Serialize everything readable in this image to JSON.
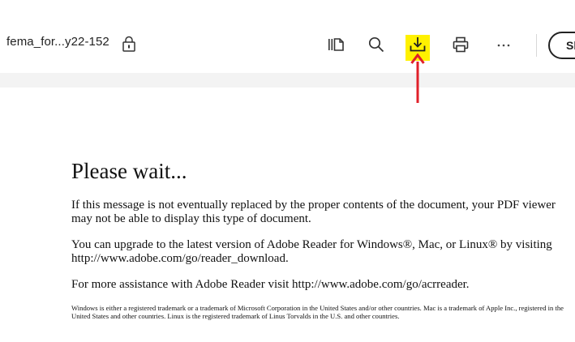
{
  "toolbar": {
    "doc_title": "fema_for...y22-152",
    "icons": [
      "page-thumbnails-icon",
      "search-icon",
      "download-icon",
      "print-icon",
      "more-options-icon",
      "lock-icon"
    ],
    "share_label": "Sh",
    "highlight_color": "#fff100",
    "arrow_color": "#e0202a"
  },
  "document": {
    "heading": "Please wait...",
    "paragraph_1": "If this message is not eventually replaced by the proper contents of the document, your PDF viewer may not be able to display this type of document.",
    "paragraph_2": "You can upgrade to the latest version of Adobe Reader for Windows®, Mac, or Linux® by visiting  http://www.adobe.com/go/reader_download.",
    "paragraph_3": "For more assistance with Adobe Reader visit  http://www.adobe.com/go/acrreader.",
    "fine_print": "Windows is either a registered trademark or a trademark of Microsoft Corporation in the United States and/or other countries. Mac is a trademark of Apple Inc., registered in the United States and other countries. Linux is the registered trademark of Linus Torvalds in the U.S. and other countries."
  }
}
